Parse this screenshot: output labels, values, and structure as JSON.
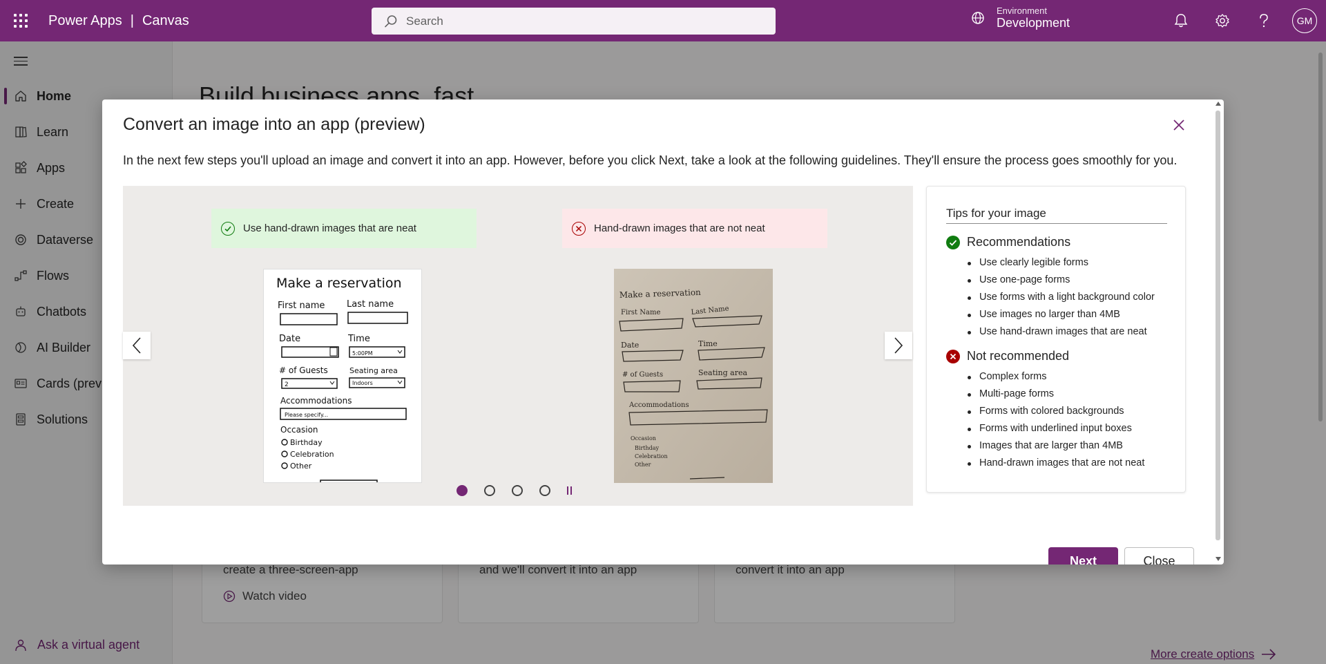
{
  "topbar": {
    "app_name": "Power Apps",
    "separator": "|",
    "section": "Canvas",
    "search_placeholder": "Search",
    "env_label": "Environment",
    "env_value": "Development",
    "avatar_initials": "GM"
  },
  "sidebar": {
    "items": [
      {
        "label": "Home",
        "icon": "home-icon"
      },
      {
        "label": "Learn",
        "icon": "book-icon"
      },
      {
        "label": "Apps",
        "icon": "apps-icon"
      },
      {
        "label": "Create",
        "icon": "plus-icon"
      },
      {
        "label": "Dataverse",
        "icon": "dataverse-icon"
      },
      {
        "label": "Flows",
        "icon": "flow-icon"
      },
      {
        "label": "Chatbots",
        "icon": "bot-icon"
      },
      {
        "label": "AI Builder",
        "icon": "ai-builder-icon"
      },
      {
        "label": "Cards (preview)",
        "icon": "cards-icon"
      },
      {
        "label": "Solutions",
        "icon": "solutions-icon"
      }
    ],
    "ask_agent": "Ask a virtual agent"
  },
  "background": {
    "title": "Build business apps, fast",
    "cards": [
      {
        "text": "create a three-screen-app",
        "link": "Watch video"
      },
      {
        "text": "and we'll convert it into an app"
      },
      {
        "text": "convert it into an app"
      }
    ],
    "more_link": "More create options"
  },
  "dialog": {
    "title": "Convert an image into an app (preview)",
    "description": "In the next few steps you'll upload an image and convert it into an app. However, before you click Next, take a look at the following guidelines. They'll ensure the process goes smoothly for you.",
    "good_label": "Use hand-drawn images that are neat",
    "bad_label": "Hand-drawn images that are not neat",
    "sample": {
      "heading": "Make a reservation",
      "first_name": "First name",
      "last_name": "Last name",
      "date": "Date",
      "time": "Time",
      "time_value": "5:00PM",
      "guests": "# of Guests",
      "guests_value": "2",
      "seating": "Seating area",
      "seating_value": "Indoors",
      "accommodations": "Accommodations",
      "accommodations_placeholder": "Please specify...",
      "occasion": "Occasion",
      "opt1": "Birthday",
      "opt2": "Celebration",
      "opt3": "Other"
    },
    "messy_sample": {
      "heading": "Make a reservation",
      "first_name": "First Name",
      "last_name": "Last Name",
      "date": "Date",
      "time": "Time",
      "guests": "# of Guests",
      "seating": "Seating area",
      "accommodations": "Accommodations",
      "occasion": "Occasion",
      "opt1": "Birthday",
      "opt2": "Celebration",
      "opt3": "Other"
    },
    "carousel_current": 1,
    "carousel_total": 4,
    "tips": {
      "title": "Tips for your image",
      "rec_heading": "Recommendations",
      "recommendations": [
        "Use clearly legible forms",
        "Use one-page forms",
        "Use forms with a light background color",
        "Use images no larger than 4MB",
        "Use hand-drawn images that are neat"
      ],
      "not_heading": "Not recommended",
      "not_recommended": [
        "Complex forms",
        "Multi-page forms",
        "Forms with colored backgrounds",
        "Forms with underlined input boxes",
        "Images that are larger than 4MB",
        "Hand-drawn images that are not neat"
      ]
    },
    "next_label": "Next",
    "close_label": "Close"
  },
  "colors": {
    "brand": "#742774",
    "good_bg": "#dff6dd",
    "bad_bg": "#fde7e9",
    "good_icon": "#107c10",
    "bad_icon": "#a80000"
  }
}
